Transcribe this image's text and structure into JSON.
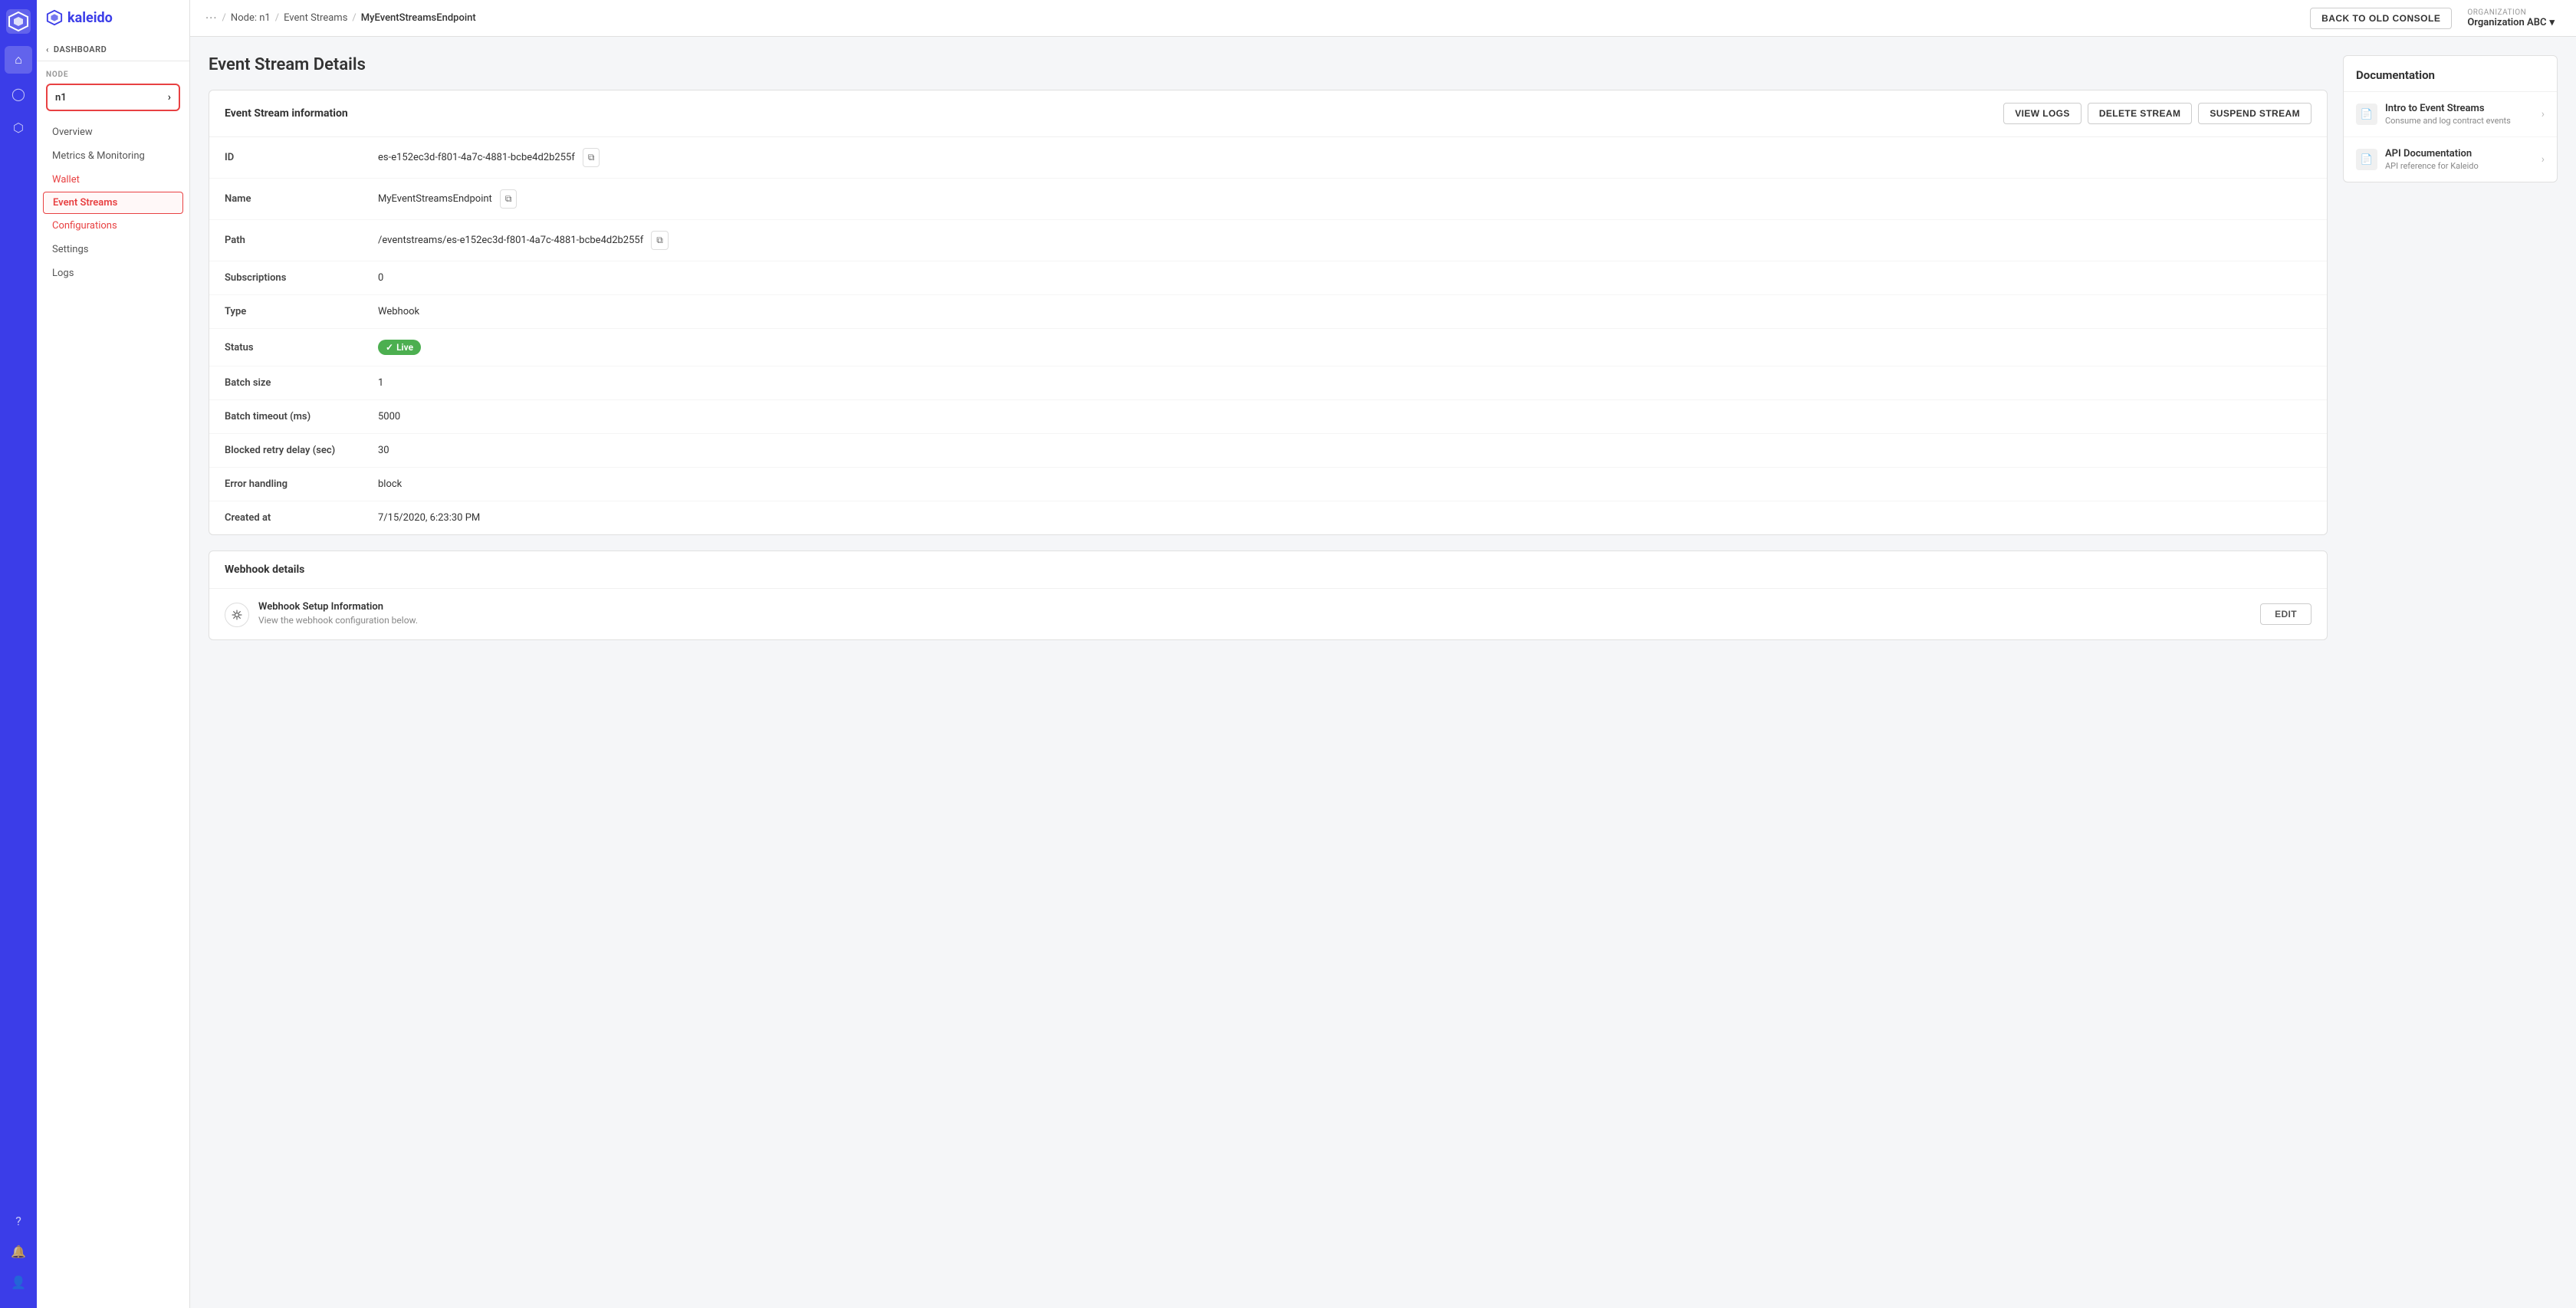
{
  "app": {
    "logo_text": "kaleido"
  },
  "topbar": {
    "dots": "···",
    "breadcrumb": {
      "node": "Node: n1",
      "event_streams": "Event Streams",
      "current": "MyEventStreamsEndpoint"
    },
    "back_console_btn": "BACK TO OLD CONSOLE",
    "org_label": "ORGANIZATION",
    "org_name": "Organization ABC"
  },
  "sidebar": {
    "back_label": "DASHBOARD",
    "node_section_label": "NODE",
    "node_name": "n1",
    "nav_items": [
      {
        "label": "Overview",
        "active": false
      },
      {
        "label": "Metrics & Monitoring",
        "active": false
      },
      {
        "label": "Wallet",
        "active": false
      },
      {
        "label": "Event Streams",
        "active": true
      },
      {
        "label": "Configurations",
        "active": false
      },
      {
        "label": "Settings",
        "active": false
      },
      {
        "label": "Logs",
        "active": false
      }
    ]
  },
  "page": {
    "title": "Event Stream Details"
  },
  "stream_info": {
    "card_title": "Event Stream information",
    "btn_view_logs": "VIEW LOGS",
    "btn_delete": "DELETE STREAM",
    "btn_suspend": "SUSPEND STREAM",
    "fields": [
      {
        "label": "ID",
        "value": "es-e152ec3d-f801-4a7c-4881-bcbe4d2b255f",
        "copyable": true
      },
      {
        "label": "Name",
        "value": "MyEventStreamsEndpoint",
        "copyable": true
      },
      {
        "label": "Path",
        "value": "/eventstreams/es-e152ec3d-f801-4a7c-4881-bcbe4d2b255f",
        "copyable": true
      },
      {
        "label": "Subscriptions",
        "value": "0",
        "copyable": false
      },
      {
        "label": "Type",
        "value": "Webhook",
        "copyable": false
      },
      {
        "label": "Status",
        "value": "Live",
        "copyable": false,
        "is_status": true
      },
      {
        "label": "Batch size",
        "value": "1",
        "copyable": false
      },
      {
        "label": "Batch timeout (ms)",
        "value": "5000",
        "copyable": false
      },
      {
        "label": "Blocked retry delay (sec)",
        "value": "30",
        "copyable": false
      },
      {
        "label": "Error handling",
        "value": "block",
        "copyable": false
      },
      {
        "label": "Created at",
        "value": "7/15/2020, 6:23:30 PM",
        "copyable": false
      }
    ]
  },
  "webhook_details": {
    "card_title": "Webhook details",
    "setup_title": "Webhook Setup Information",
    "setup_sub": "View the webhook configuration below.",
    "btn_edit": "EDIT"
  },
  "documentation": {
    "section_title": "Documentation",
    "items": [
      {
        "title": "Intro to Event Streams",
        "subtitle": "Consume and log contract events"
      },
      {
        "title": "API Documentation",
        "subtitle": "API reference for Kaleido"
      }
    ]
  },
  "icons": {
    "home": "⌂",
    "globe": "🌐",
    "network": "⬡",
    "question": "?",
    "bell": "🔔",
    "user": "👤",
    "chevron_right": "›",
    "chevron_down": "▾",
    "back_arrow": "‹",
    "copy": "⧉",
    "check": "✓",
    "webhook": "⚙",
    "doc": "📄"
  }
}
